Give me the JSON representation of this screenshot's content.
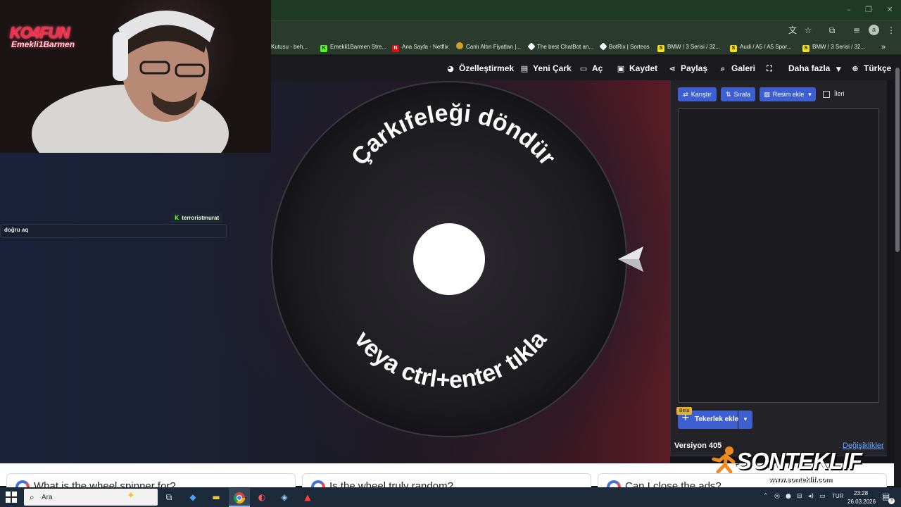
{
  "browser": {
    "window_controls": [
      "–",
      "❐",
      "✕"
    ],
    "toolbar_icons": [
      "translate-icon",
      "star-icon",
      "extensions-icon",
      "tab-search-icon",
      "menu-icon"
    ],
    "profile_initial": "a",
    "bookmarks": [
      {
        "label": "Kutusu - beh...",
        "icon": "generic"
      },
      {
        "label": "Emekli1Barmen Stre...",
        "icon": "K",
        "color": "#53fc18"
      },
      {
        "label": "Ana Sayfa - Netflix",
        "icon": "N",
        "color": "#e50914"
      },
      {
        "label": "Canlı Altın Fiyatları |...",
        "icon": "gold",
        "color": "#c9a227"
      },
      {
        "label": "The best ChatBot an...",
        "icon": "bot",
        "color": "#ffffff"
      },
      {
        "label": "BotRix | Sorteos",
        "icon": "bot",
        "color": "#ffffff"
      },
      {
        "label": "BMW / 3 Serisi / 32...",
        "icon": "S",
        "color": "#f5e019"
      },
      {
        "label": "Audi / A5 / A5 Spor...",
        "icon": "S",
        "color": "#f5e019"
      },
      {
        "label": "BMW / 3 Serisi / 32...",
        "icon": "S",
        "color": "#f5e019"
      }
    ],
    "bookmarks_overflow": "»"
  },
  "site_nav": {
    "customize": "Özelleştirmek",
    "new_wheel": "Yeni Çark",
    "open": "Aç",
    "save": "Kaydet",
    "share": "Paylaş",
    "gallery": "Galeri",
    "more": "Daha fazla",
    "language": "Türkçe"
  },
  "wheel": {
    "top_text": "Çarkıfeleği döndür",
    "bottom_text": "veya ctrl+enter tıkla"
  },
  "panel": {
    "shuffle": "Karıştır",
    "sort": "Sırala",
    "add_image": "Resim ekle",
    "advanced": "İleri",
    "add_wheel": "Tekerlek ekle",
    "beta": "Beta",
    "version": "Versiyon 405",
    "changes": "Değişiklikler"
  },
  "faq": [
    "What is the wheel spinner for?",
    "Is the wheel truly random?",
    "Can I close the ads?"
  ],
  "stream": {
    "logo": "KO4FUN",
    "logo_sub": "Emekli1Barmen",
    "chat_user": "terroristmurat",
    "chat_message": "doğru aq",
    "sponsor": "SONTEKLIF",
    "sponsor_url": "www.sonteklif.com"
  },
  "taskbar": {
    "search_placeholder": "Ara",
    "language": "TUR",
    "time": "23:28",
    "date": "26.03.2026",
    "notification_count": "3"
  },
  "colors": {
    "accent_blue": "#3d5fd2",
    "chrome_green": "#2a3a2c",
    "kick_green": "#53fc18"
  }
}
